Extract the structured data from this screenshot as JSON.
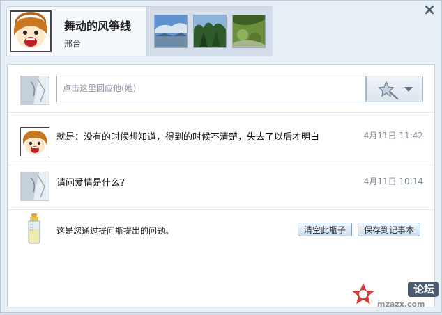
{
  "profile": {
    "name": "舞动的风筝线",
    "location": "邢台"
  },
  "reply": {
    "placeholder": "点击这里回应他(她)"
  },
  "messages": [
    {
      "text": "就是：没有的时候想知道，得到的时候不清楚，失去了以后才明白",
      "time": "4月11日 11:42"
    },
    {
      "text": "请问爱情是什么？",
      "time": "4月11日 10:14"
    }
  ],
  "footer": {
    "note": "这是您通过提问瓶提出的问题。",
    "clear_label": "清空此瓶子",
    "save_label": "保存到记事本"
  },
  "watermark": {
    "text": "论坛",
    "sub": "mzazx.com"
  },
  "colors": {
    "background": "#e6eef6",
    "panel": "#ffffff",
    "button_border": "#7f9fc2"
  }
}
